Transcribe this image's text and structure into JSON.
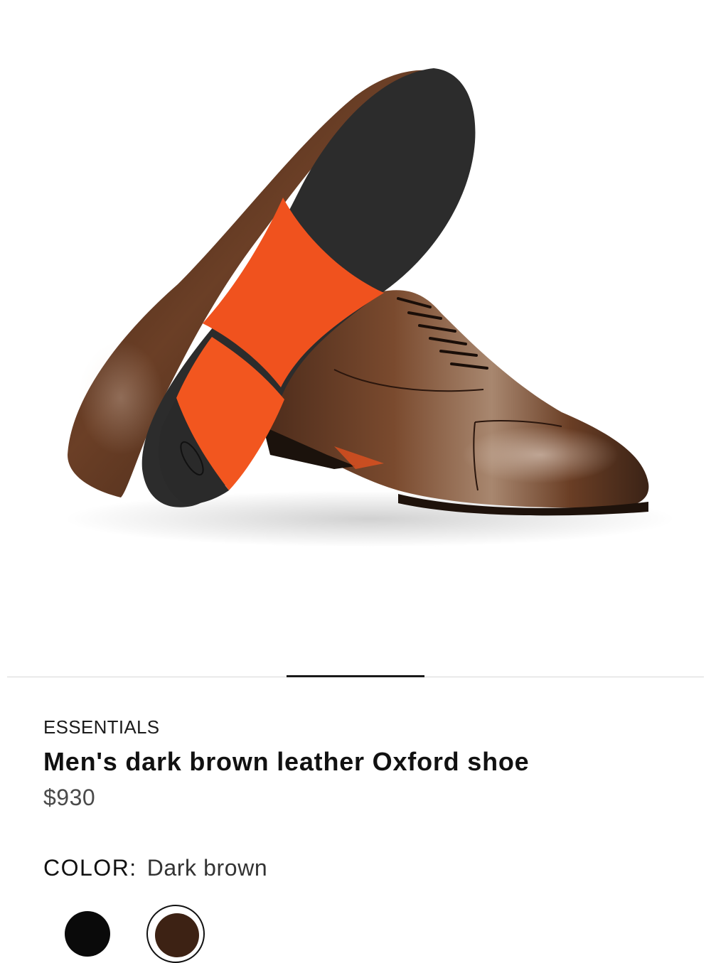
{
  "product": {
    "collection": "ESSENTIALS",
    "title": "Men's dark brown leather Oxford shoe",
    "price": "$930",
    "color_label": "COLOR:",
    "color_value": "Dark brown"
  },
  "gallery": {
    "current_index": 2,
    "image_subject": "pair of dark brown leather Oxford shoes"
  },
  "swatches": [
    {
      "name": "Black",
      "color": "#0a0a0a",
      "selected": false
    },
    {
      "name": "Dark brown",
      "color": "#3d2214",
      "selected": true
    }
  ],
  "colors": {
    "leather": "#5a3422",
    "sole_accent": "#f0521e",
    "sole_dark": "#2b2b2b"
  }
}
